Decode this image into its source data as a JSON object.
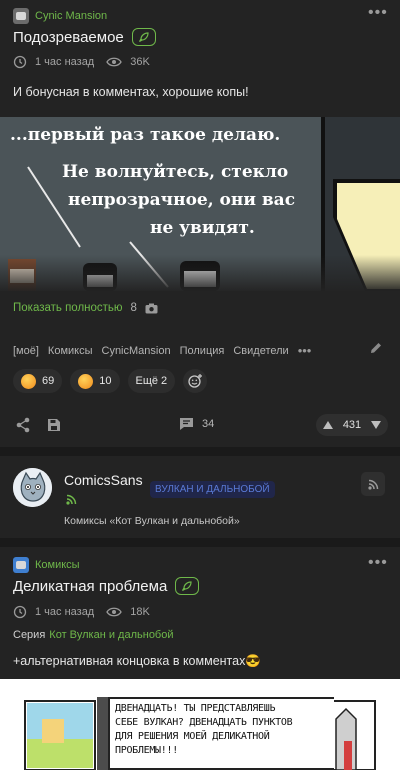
{
  "post1": {
    "community": "Cynic Mansion",
    "title": "Подозреваемое",
    "time": "1 час назад",
    "views": "36K",
    "text": "И бонусная в комментах, хорошие копы!",
    "comic_lines": [
      "...первый раз такое делаю.",
      "Не волнуйтесь, стекло",
      "непрозрачное, они вас",
      "не увидят."
    ],
    "show_full": "Показать полностью",
    "image_count": "8",
    "tags": [
      "[моё]",
      "Комиксы",
      "CynicMansion",
      "Полиция",
      "Свидетели"
    ],
    "reactions": [
      {
        "icon": "grinning-face-icon",
        "count": "69"
      },
      {
        "icon": "laughing-face-icon",
        "count": "10"
      }
    ],
    "more_reactions": "Ещё 2",
    "comments": "34",
    "rating": "431"
  },
  "author": {
    "name": "ComicsSans",
    "tag": "ВУЛКАН И ДАЛЬНОБОЙ",
    "subtitle": "Комиксы «Кот Вулкан и дальнобой»"
  },
  "post2": {
    "community": "Комиксы",
    "title": "Деликатная проблема",
    "time": "1 час назад",
    "views": "18K",
    "series_label": "Серия",
    "series_link": "Кот Вулкан и дальнобой",
    "text": "+альтернативная концовка в комментах😎",
    "comic_lines": [
      "ДВЕНАДЦАТЬ! ТЫ ПРЕДСТАВЛЯЕШЬ",
      "СЕБЕ ВУЛКАН? ДВЕНАДЦАТЬ ПУНКТОВ",
      "ДЛЯ РЕШЕНИЯ МОЕЙ ДЕЛИКАТНОЙ",
      "ПРОБЛЕМЫ!!!"
    ]
  },
  "colors": {
    "bg": "#232323",
    "accent": "#6fb84a",
    "tag_blue": "#5a7ad6"
  }
}
